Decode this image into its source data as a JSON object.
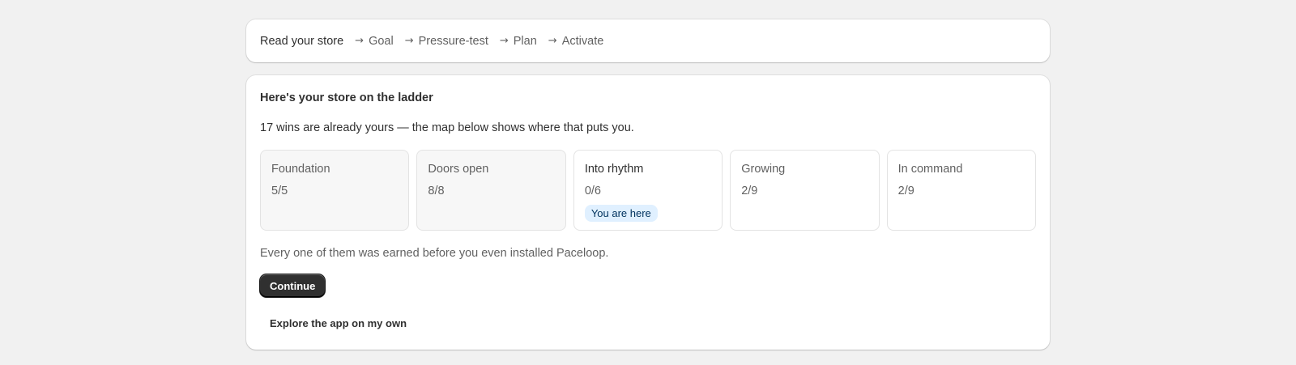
{
  "progress": {
    "steps": [
      {
        "label": "Read your store",
        "arrow": "",
        "current": true
      },
      {
        "label": "Goal",
        "arrow": "→",
        "current": false
      },
      {
        "label": "Pressure-test",
        "arrow": "→",
        "current": false
      },
      {
        "label": "Plan",
        "arrow": "→",
        "current": false
      },
      {
        "label": "Activate",
        "arrow": "→",
        "current": false
      }
    ]
  },
  "main": {
    "title": "Here's your store on the ladder",
    "subtitle": "17 wins are already yours — the map below shows where that puts you.",
    "stages": [
      {
        "name": "Foundation",
        "count": "5/5",
        "state": "done"
      },
      {
        "name": "Doors open",
        "count": "8/8",
        "state": "done"
      },
      {
        "name": "Into rhythm",
        "count": "0/6",
        "state": "current",
        "badge": "You are here"
      },
      {
        "name": "Growing",
        "count": "2/9",
        "state": "upcoming"
      },
      {
        "name": "In command",
        "count": "2/9",
        "state": "upcoming"
      }
    ],
    "note": "Every one of them was earned before you even installed Paceloop.",
    "continue_label": "Continue",
    "explore_label": "Explore the app on my own"
  },
  "colors": {
    "background": "#f1f1f1",
    "card": "#ffffff",
    "primary_button": "#303030",
    "badge_bg": "#e0f0ff",
    "badge_text": "#00325c"
  }
}
